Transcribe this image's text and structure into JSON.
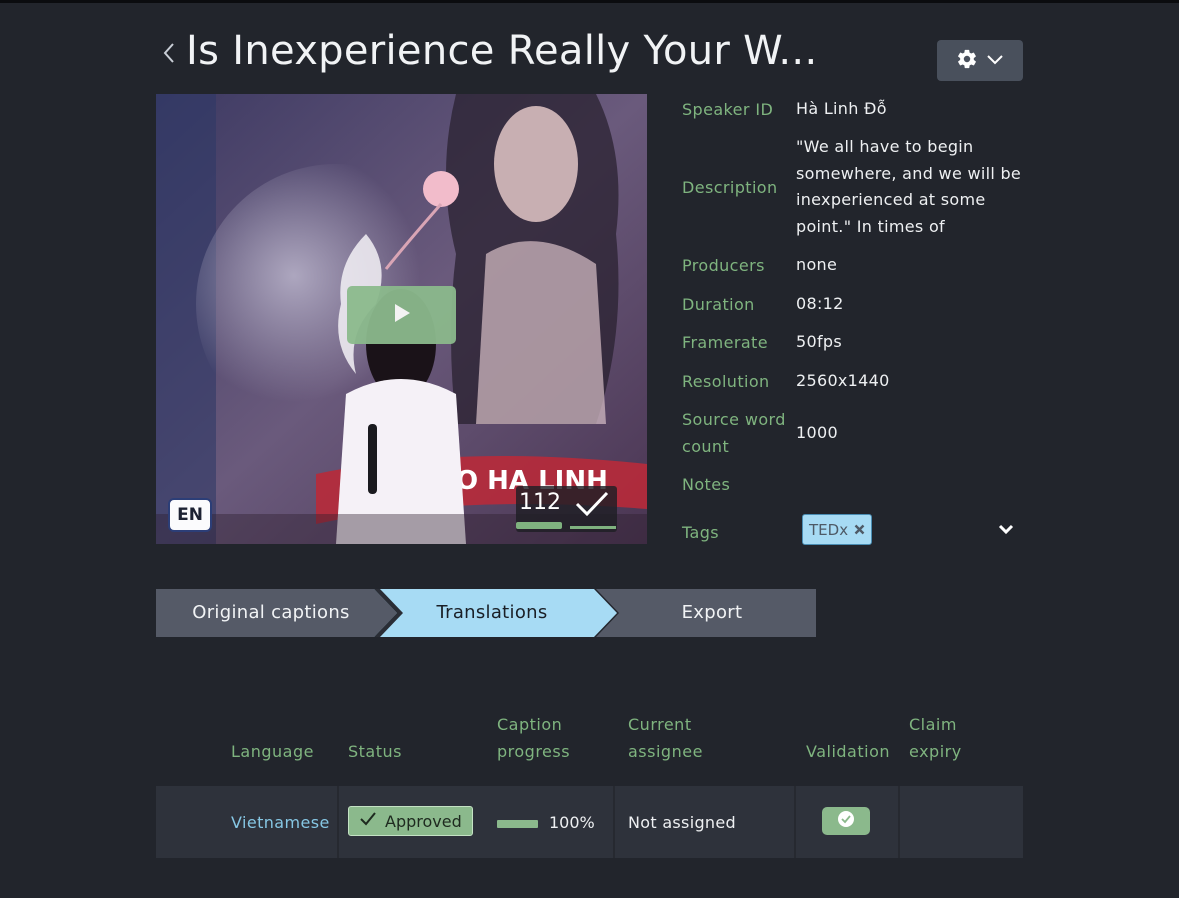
{
  "header": {
    "title": "Is Inexperience Really Your W...",
    "back_icon": "chevron-left-icon",
    "settings_icons": [
      "gear-icon",
      "chevron-down-icon"
    ]
  },
  "video": {
    "language_badge": "EN",
    "caption_count": "112",
    "play_icon": "play-icon",
    "scene_text": "O HA LINH"
  },
  "metadata": {
    "speaker_id_label": "Speaker ID",
    "speaker_id_value": "Hà Linh Đỗ",
    "description_label": "Description",
    "description_value": "\"We all have to begin somewhere, and we will be inexperienced at some point.\" In times of economic",
    "producers_label": "Producers",
    "producers_value": "none",
    "duration_label": "Duration",
    "duration_value": "08:12",
    "framerate_label": "Framerate",
    "framerate_value": "50fps",
    "resolution_label": "Resolution",
    "resolution_value": "2560x1440",
    "source_word_count_label": "Source word count",
    "source_word_count_value": "1000",
    "notes_label": "Notes",
    "tags_label": "Tags",
    "tags": [
      "TEDx"
    ]
  },
  "steps": {
    "items": [
      "Original captions",
      "Translations",
      "Export"
    ],
    "active": "Translations"
  },
  "table": {
    "headers": {
      "language": "Language",
      "status": "Status",
      "caption_progress": "Caption progress",
      "current_assignee": "Current assignee",
      "validation": "Validation",
      "claim_expiry": "Claim expiry"
    },
    "rows": [
      {
        "language": "Vietnamese",
        "status": "Approved",
        "progress_value": 100,
        "progress_text": "100%",
        "assignee": "Not assigned",
        "validation": true,
        "claim_expiry": ""
      }
    ]
  },
  "colors": {
    "background": "#22252c",
    "accent_green": "#8bb98c",
    "label_green": "#7fb47f",
    "active_step": "#a7dbf4",
    "inactive_step": "#555a67",
    "link_blue": "#86c7e4"
  }
}
